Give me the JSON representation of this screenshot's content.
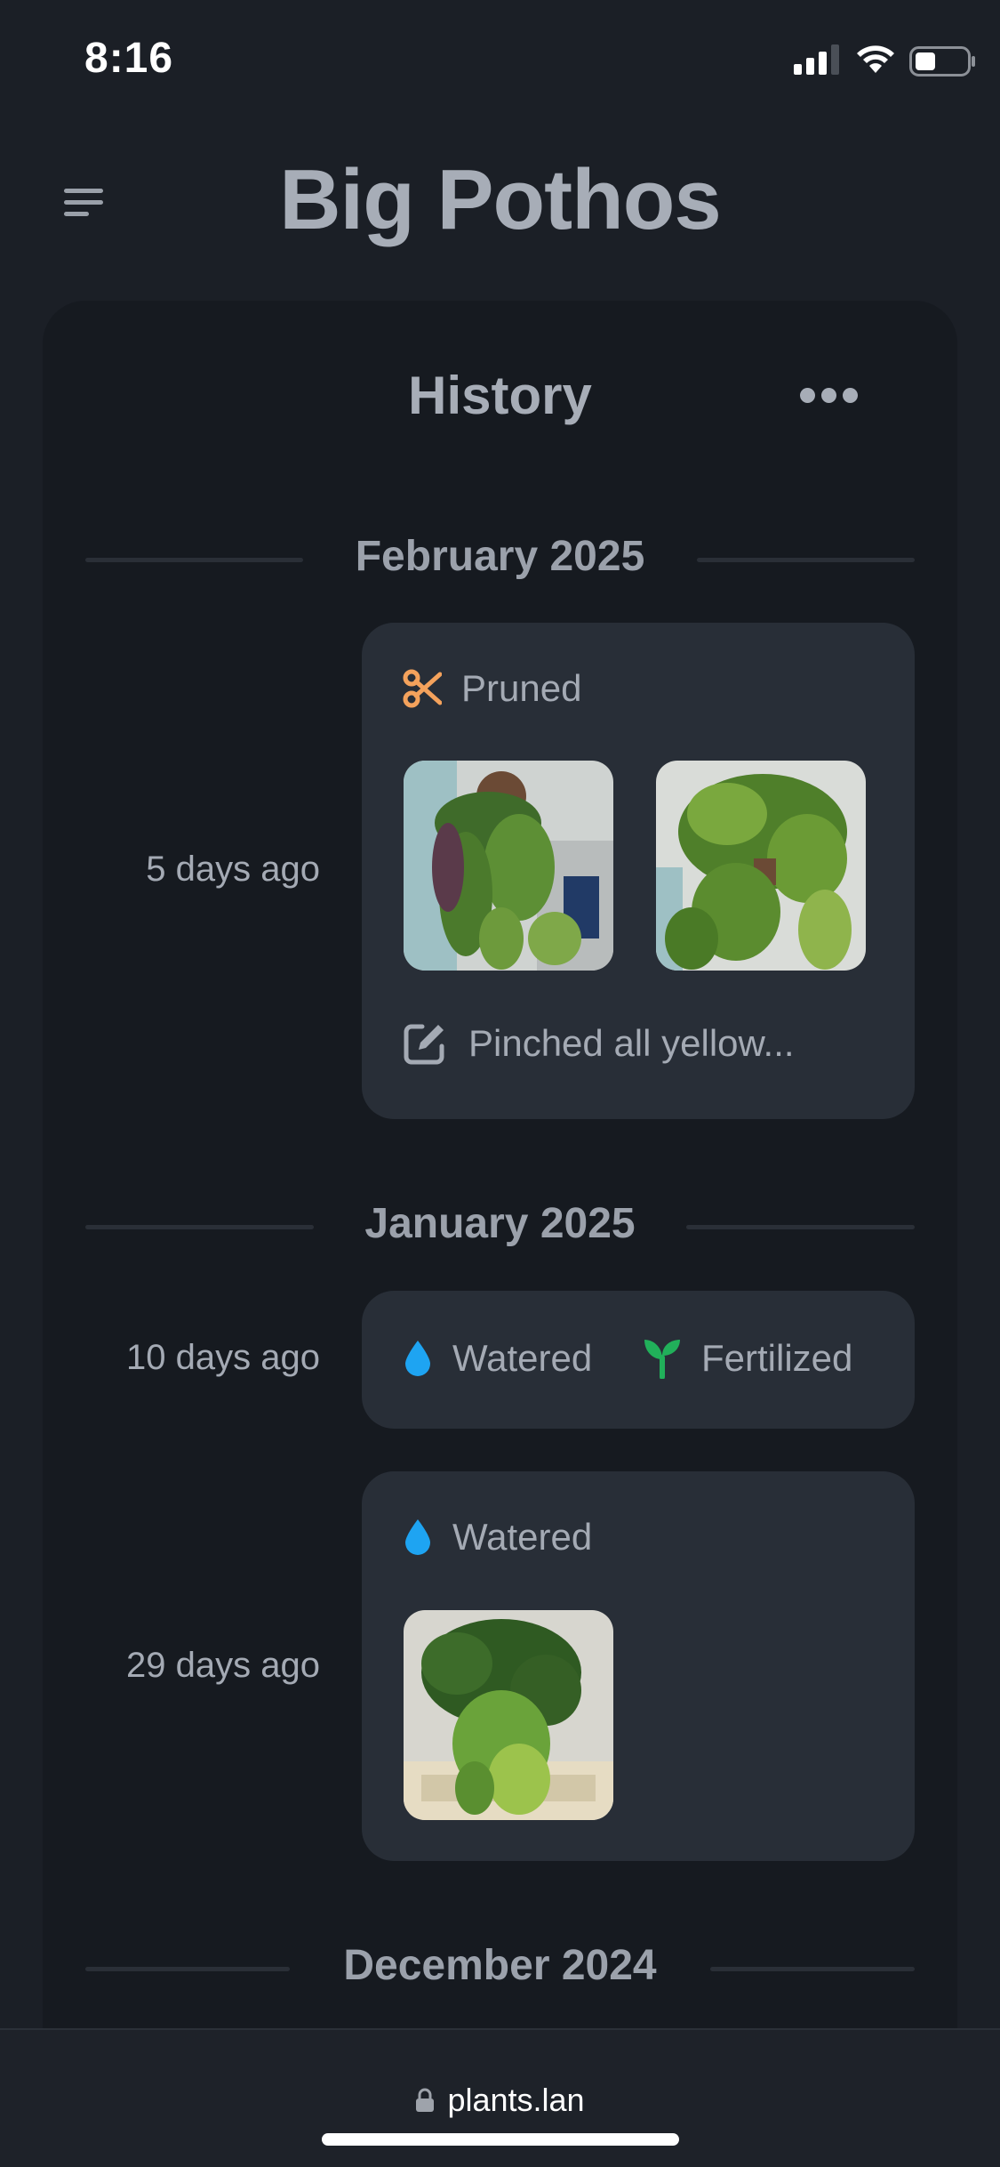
{
  "status_bar": {
    "time": "8:16"
  },
  "header": {
    "title": "Big Pothos"
  },
  "history": {
    "title": "History",
    "groups": [
      {
        "month": "February 2025",
        "entries": [
          {
            "date": "5 days ago",
            "tags": [
              {
                "label": "Pruned",
                "icon": "scissors-icon",
                "color": "#f4a25c"
              }
            ],
            "photos": 2,
            "note": "Pinched all yellow..."
          }
        ]
      },
      {
        "month": "January 2025",
        "entries": [
          {
            "date": "10 days ago",
            "tags": [
              {
                "label": "Watered",
                "icon": "water-drop-icon",
                "color": "#1ea4f2"
              },
              {
                "label": "Fertilized",
                "icon": "sprout-icon",
                "color": "#21b05a"
              }
            ]
          },
          {
            "date": "29 days ago",
            "tags": [
              {
                "label": "Watered",
                "icon": "water-drop-icon",
                "color": "#1ea4f2"
              }
            ],
            "photos": 1
          }
        ]
      },
      {
        "month": "December 2024",
        "entries": []
      }
    ]
  },
  "browser": {
    "url": "plants.lan"
  }
}
